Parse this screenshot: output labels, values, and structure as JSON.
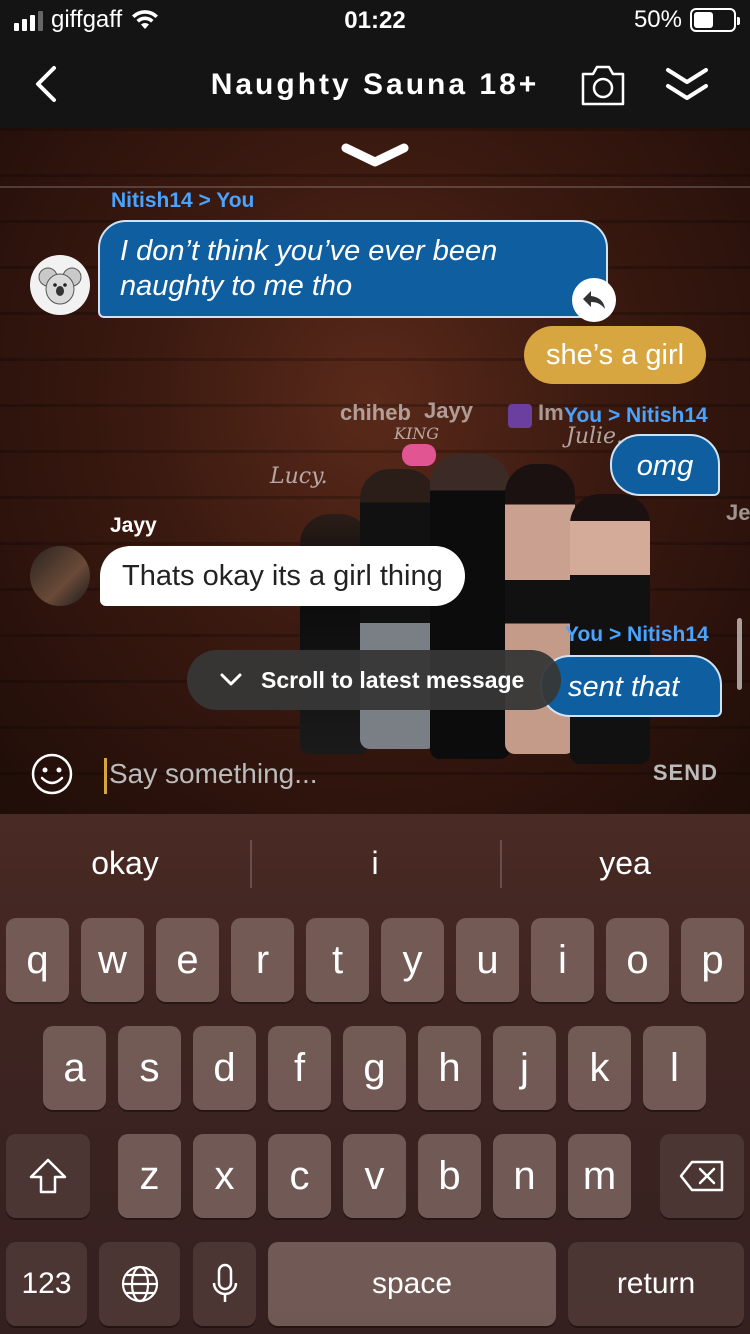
{
  "status_bar": {
    "carrier": "giffgaff",
    "time": "01:22",
    "battery_percent": "50%",
    "battery_level": 0.5
  },
  "header": {
    "title": "Naughty Sauna 18+"
  },
  "chat": {
    "messages": [
      {
        "meta": "Nitish14 > You",
        "text_line1": "I don’t think you’ve ever been",
        "text_line2": "naughty to me tho"
      },
      {
        "text": "she’s a girl"
      },
      {
        "meta": "You > Nitish14",
        "text": "omg"
      },
      {
        "meta": "Jayy",
        "text": "Thats okay its a girl thing"
      },
      {
        "meta": "You > Nitish14",
        "text": "sent that"
      }
    ],
    "floating_names": {
      "name1": "chiheb",
      "name2": "Jayy",
      "name3": "Im",
      "name4": "Julie.",
      "name5": "Lucy.",
      "name6": "Je",
      "name7": "KING"
    },
    "scroll_button": "Scroll to latest message"
  },
  "composer": {
    "placeholder": "Say something...",
    "send_label": "SEND"
  },
  "keyboard": {
    "suggestions": [
      "okay",
      "i",
      "yea"
    ],
    "row1": [
      "q",
      "w",
      "e",
      "r",
      "t",
      "y",
      "u",
      "i",
      "o",
      "p"
    ],
    "row2": [
      "a",
      "s",
      "d",
      "f",
      "g",
      "h",
      "j",
      "k",
      "l"
    ],
    "row3": [
      "z",
      "x",
      "c",
      "v",
      "b",
      "n",
      "m"
    ],
    "numbers_label": "123",
    "space_label": "space",
    "return_label": "return"
  },
  "colors": {
    "accent_blue": "#0f5fa0",
    "meta_blue": "#4aa3ff",
    "gold": "#d8a640"
  }
}
